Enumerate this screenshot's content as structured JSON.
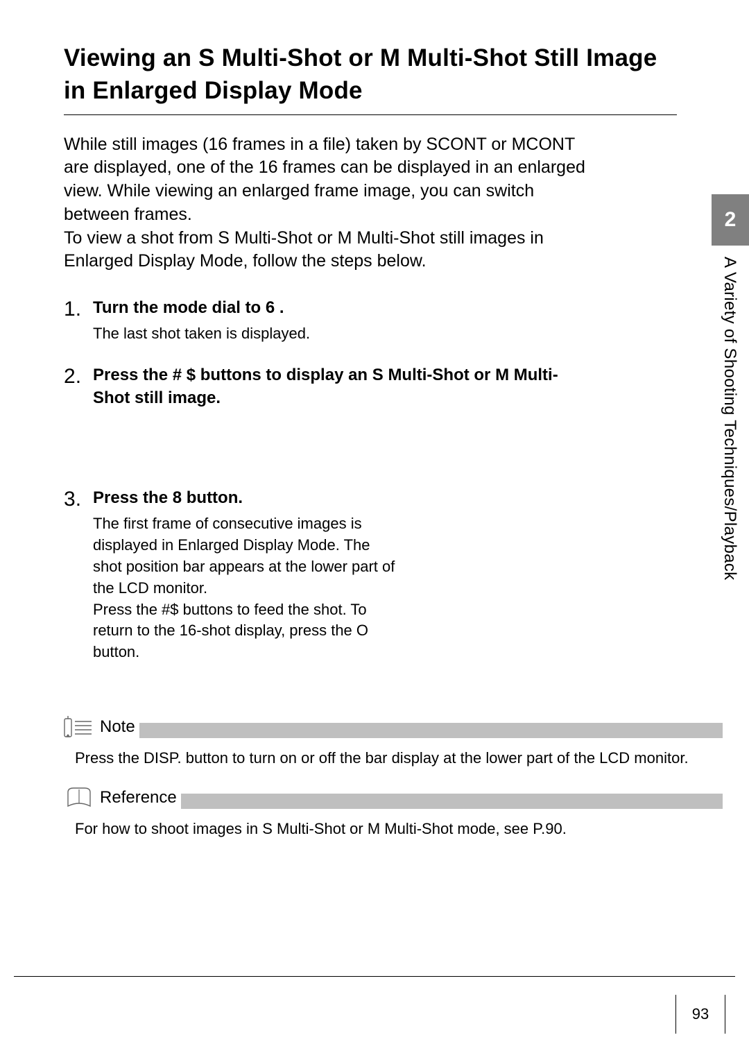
{
  "title": "Viewing an S Multi-Shot or M Multi-Shot Still Image in Enlarged Display Mode",
  "intro": "While still images (16 frames in a file) taken by SCONT or MCONT are displayed, one of the 16 frames can be displayed in an enlarged view. While viewing an enlarged frame image, you can switch between frames.\nTo view a shot from S Multi-Shot or M Multi-Shot still images in Enlarged Display Mode, follow the steps below.",
  "steps": [
    {
      "num": "1",
      "head": "Turn the mode dial to 6 .",
      "sub": "The last shot taken is displayed."
    },
    {
      "num": "2",
      "head": "Press the # $  buttons to display an S Multi-Shot or M Multi-Shot still image.",
      "sub": ""
    },
    {
      "num": "3",
      "head": "Press the 8  button.",
      "sub": "The first frame of consecutive images is displayed in Enlarged Display Mode. The shot position bar appears at the lower part of the LCD monitor.\nPress the #$   buttons to feed the shot. To return to the 16-shot display, press the O    button."
    }
  ],
  "note": {
    "label": "Note",
    "text": "Press the DISP. button to turn on or off the bar display at the lower part of the LCD monitor."
  },
  "reference": {
    "label": "Reference",
    "text": "For how to shoot images in S Multi-Shot or M Multi-Shot mode, see P.90."
  },
  "side": {
    "chapter_num": "2",
    "chapter_label": "A Variety of Shooting Techniques/Playback"
  },
  "page_number": "93"
}
